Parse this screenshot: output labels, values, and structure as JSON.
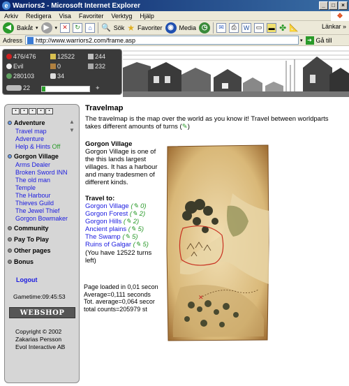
{
  "window": {
    "title": "Warriors2 - Microsoft Internet Explorer"
  },
  "menubar": {
    "items": [
      "Arkiv",
      "Redigera",
      "Visa",
      "Favoriter",
      "Verktyg",
      "Hjälp"
    ]
  },
  "toolbar": {
    "back_label": "Bakåt",
    "search_label": "Sök",
    "favorites_label": "Favoriter",
    "media_label": "Media",
    "links_label": "Länkar"
  },
  "address": {
    "label": "Adress",
    "url": "http://www.warriors2.com/frame.asp",
    "go_label": "Gå till"
  },
  "stats": {
    "hp": "476/476",
    "gold": "12522",
    "stat1": "244",
    "alignment": "Evil",
    "stat2": "0",
    "stat3": "232",
    "exp": "280103",
    "stat4": "34",
    "level": "22",
    "exp_progress": 0.08
  },
  "sidebar": {
    "sections": {
      "adventure": "Adventure",
      "gorgon_village": "Gorgon Village",
      "community": "Community",
      "pay_to_play": "Pay To Play",
      "other_pages": "Other pages",
      "bonus": "Bonus"
    },
    "adventure_links": [
      "Travel map",
      "Adventure",
      "Help & Hints"
    ],
    "help_off": "Off",
    "village_links": [
      "Arms Dealer",
      "Broken Sword INN",
      "The old man",
      "Temple",
      "The Harbour",
      "Thieves Guild",
      "The Jewel Thief",
      "Gorgon Bowmaker"
    ],
    "logout": "Logout",
    "gametime": "Gametime:09:45:53",
    "webshop": "WEBSHOP",
    "copyright": [
      "Copyright © 2002",
      "Zakarias Persson",
      "Evol Interactive AB"
    ]
  },
  "main": {
    "title": "Travelmap",
    "intro": "The travelmap is the map over the world as you know it! Travel between worldparts takes different amounts of turns",
    "intro_end": ")",
    "location_title": "Gorgon Village",
    "location_desc": "Gorgon Village is one of the this lands largest villages. It has a harbour and many tradesmen of different kinds.",
    "travel_title": "Travel to:",
    "destinations": [
      {
        "name": "Gorgon Village",
        "turns": "0"
      },
      {
        "name": "Gorgon Forest",
        "turns": "2"
      },
      {
        "name": "Gorgon Hills",
        "turns": "2"
      },
      {
        "name": "Ancient plains",
        "turns": "5"
      },
      {
        "name": "The Swamp",
        "turns": "5"
      },
      {
        "name": "Ruins of Galgar",
        "turns": "5"
      }
    ],
    "turns_note": "(You have 12522 turns left)",
    "load_info": [
      "Page loaded in 0,01 secon",
      "Average=0,111 seconds",
      "Tot. average=0,064 secor",
      "total counts=205979 st"
    ]
  }
}
